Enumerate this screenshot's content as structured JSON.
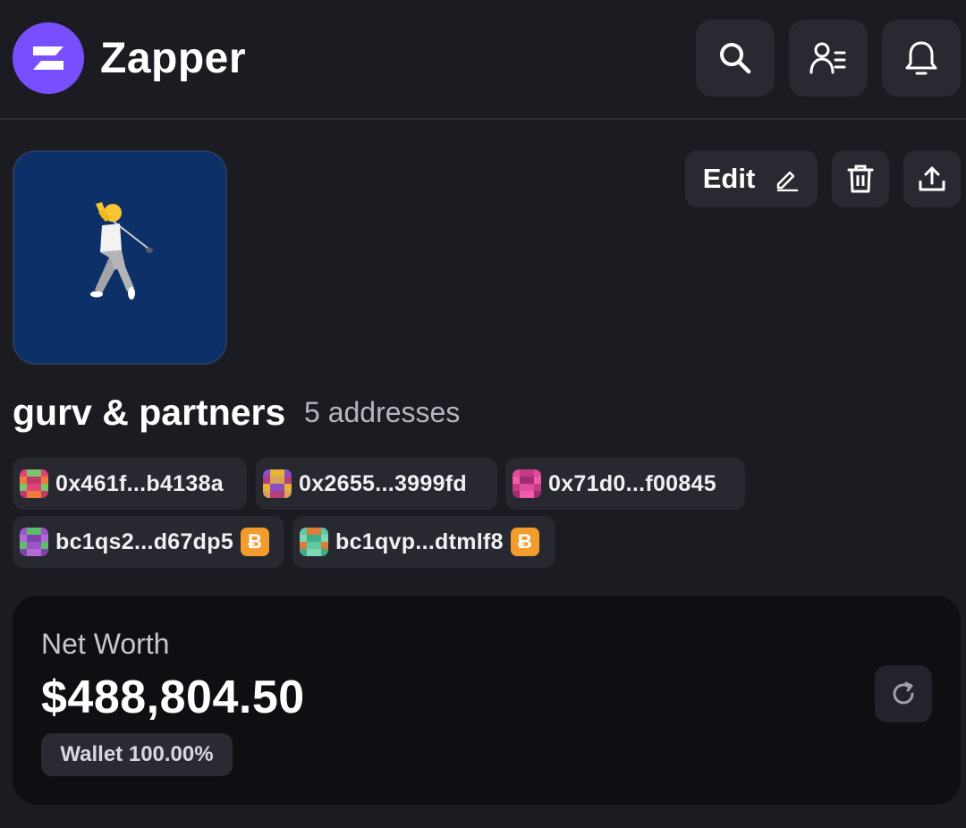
{
  "header": {
    "app_title": "Zapper",
    "icons": [
      "zapper-logo-icon",
      "search-icon",
      "user-list-icon",
      "bell-icon"
    ]
  },
  "bundle": {
    "name": "gurv & partners",
    "address_count": "5 addresses",
    "avatar_icon": "golfer-icon",
    "actions": {
      "edit_label": "Edit"
    },
    "addresses": [
      {
        "label": "0x461f...b4138a",
        "btc": false,
        "colors": [
          "#e0457a",
          "#7cc46a",
          "#f07a3a",
          "#c2386a"
        ]
      },
      {
        "label": "0x2655...3999fd",
        "btc": false,
        "colors": [
          "#8a4fc2",
          "#e6b23a",
          "#b23e7a",
          "#d9a25a"
        ]
      },
      {
        "label": "0x71d0...f00845",
        "btc": false,
        "colors": [
          "#e04a9a",
          "#c43a86",
          "#f25aaa",
          "#a02c70"
        ]
      },
      {
        "label": "bc1qs2...d67dp5",
        "btc": true,
        "btc_symbol": "Ƀ",
        "colors": [
          "#9a55c8",
          "#5bbf6a",
          "#b36ad6",
          "#7f43b0"
        ]
      },
      {
        "label": "bc1qvp...dtmlf8",
        "btc": true,
        "btc_symbol": "Ƀ",
        "colors": [
          "#5ec9a2",
          "#e07a3a",
          "#7fd6b4",
          "#3fae86"
        ]
      }
    ]
  },
  "net_worth": {
    "label": "Net Worth",
    "value": "$488,804.50",
    "breakdown": "Wallet 100.00%"
  },
  "colors": {
    "background": "#1b1c22",
    "accent": "#784ffe",
    "button": "#292a31",
    "card": "#0e0f13",
    "btc": "#f39c2e",
    "bundle_avatar_bg": "#0e3068"
  }
}
